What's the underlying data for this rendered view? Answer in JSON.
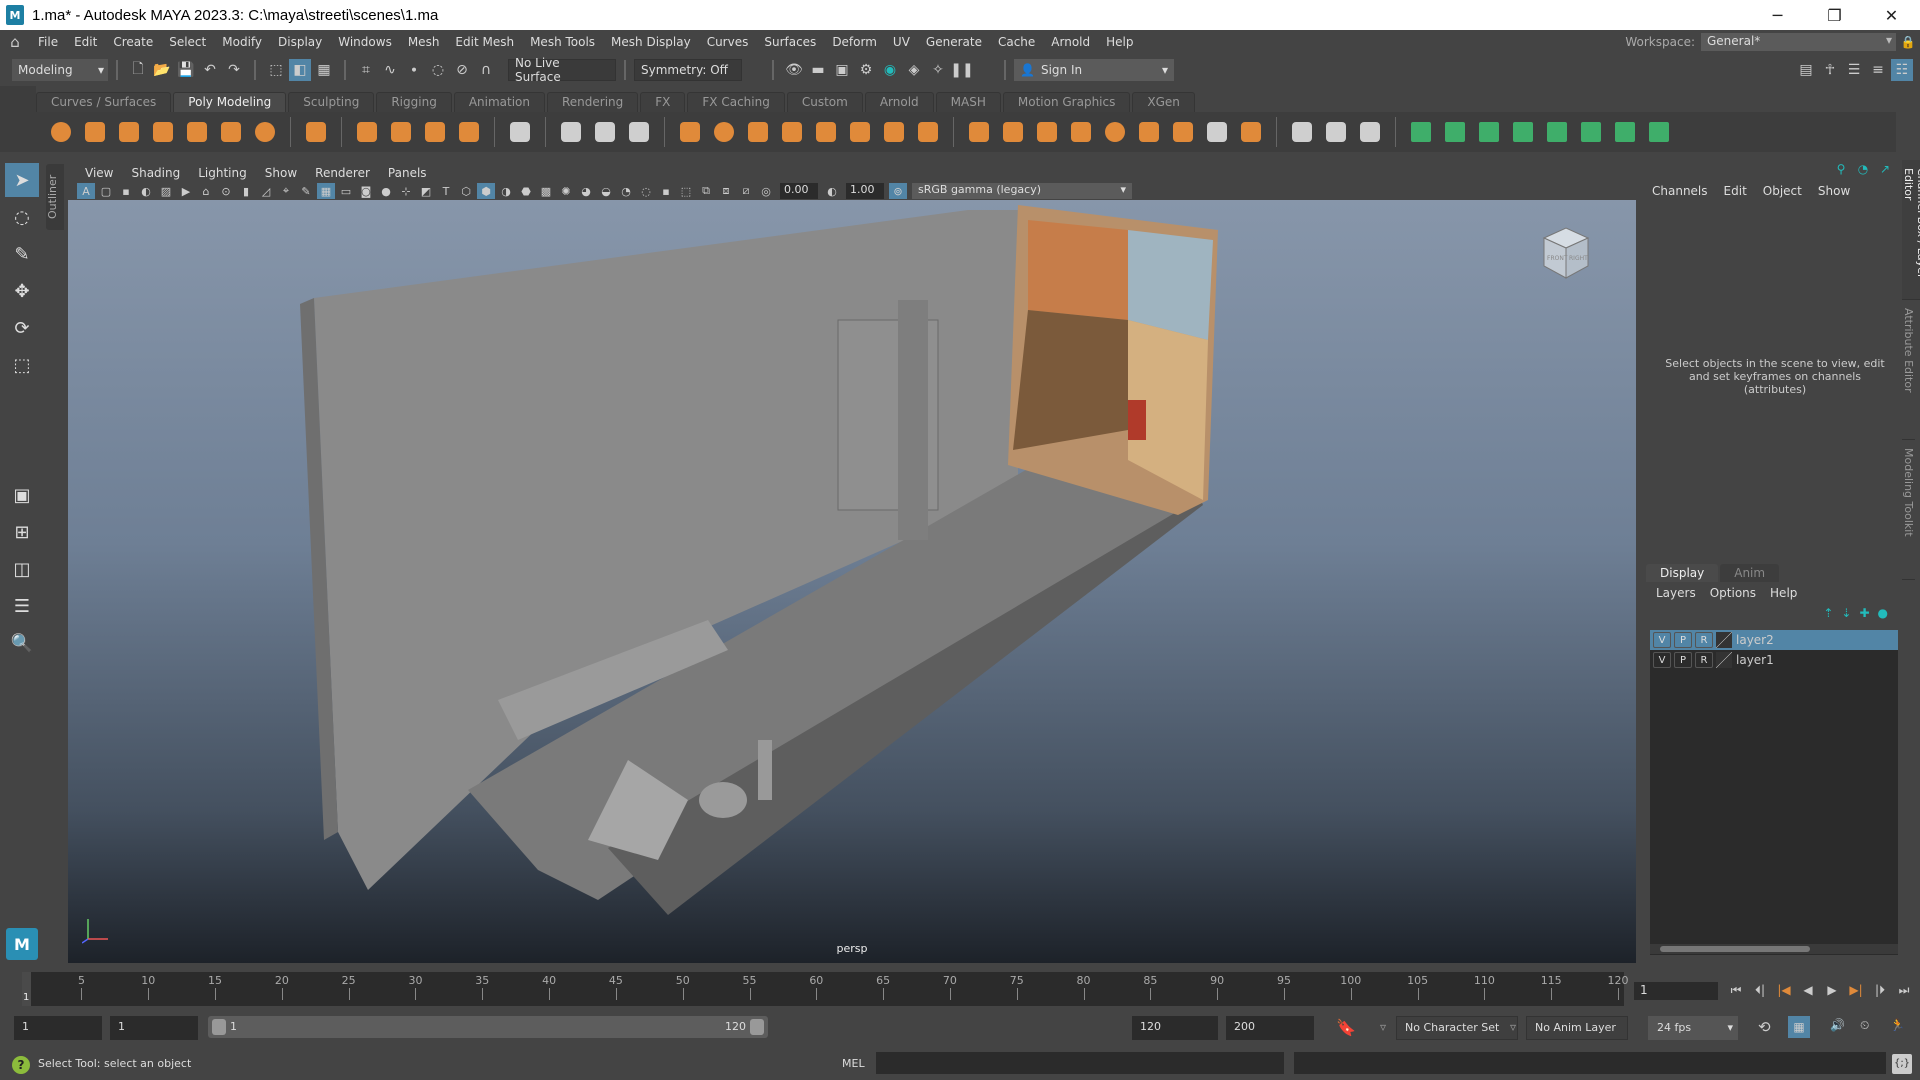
{
  "window": {
    "title": "1.ma* - Autodesk MAYA 2023.3: C:\\maya\\streeti\\scenes\\1.ma",
    "logo": "M"
  },
  "menubar": {
    "items": [
      "File",
      "Edit",
      "Create",
      "Select",
      "Modify",
      "Display",
      "Windows",
      "Mesh",
      "Edit Mesh",
      "Mesh Tools",
      "Mesh Display",
      "Curves",
      "Surfaces",
      "Deform",
      "UV",
      "Generate",
      "Cache",
      "Arnold",
      "Help"
    ],
    "workspace_label": "Workspace:",
    "workspace_value": "General*"
  },
  "statusline": {
    "mode": "Modeling",
    "live_surface": "No Live Surface",
    "symmetry": "Symmetry: Off",
    "sign_in": "Sign In"
  },
  "shelf": {
    "tabs": [
      "Curves / Surfaces",
      "Poly Modeling",
      "Sculpting",
      "Rigging",
      "Animation",
      "Rendering",
      "FX",
      "FX Caching",
      "Custom",
      "Arnold",
      "MASH",
      "Motion Graphics",
      "XGen"
    ],
    "active_tab": "Poly Modeling"
  },
  "toolbox": {
    "outliner_tab": "Outliner",
    "logo": "M"
  },
  "viewport": {
    "menus": [
      "View",
      "Shading",
      "Lighting",
      "Show",
      "Renderer",
      "Panels"
    ],
    "exposure": "0.00",
    "gamma": "1.00",
    "color_space": "sRGB gamma (legacy)",
    "camera": "persp",
    "viewcube": {
      "front": "FRONT",
      "right": "RIGHT"
    }
  },
  "channel_box": {
    "menus": [
      "Channels",
      "Edit",
      "Object",
      "Show"
    ],
    "message": "Select objects in the scene to view, edit and set keyframes on channels (attributes)"
  },
  "layer_editor": {
    "tabs": [
      "Display",
      "Anim"
    ],
    "menus": [
      "Layers",
      "Options",
      "Help"
    ],
    "layers": [
      {
        "v": "V",
        "p": "P",
        "r": "R",
        "name": "layer2",
        "selected": true
      },
      {
        "v": "V",
        "p": "P",
        "r": "R",
        "name": "layer1",
        "selected": false
      }
    ]
  },
  "side_tabs": [
    "Channel Box / Layer Editor",
    "Attribute Editor",
    "Modeling Toolkit"
  ],
  "timeline": {
    "start": 1,
    "end": 120,
    "current": "1",
    "ticks": [
      5,
      10,
      15,
      20,
      25,
      30,
      35,
      40,
      45,
      50,
      55,
      60,
      65,
      70,
      75,
      80,
      85,
      90,
      95,
      100,
      105,
      110,
      115,
      120
    ],
    "current_frame_field": "1"
  },
  "range": {
    "start_field": "1",
    "playback_start": "1",
    "range_start_label": "1",
    "range_end_label": "120",
    "playback_end": "120",
    "end_field": "200",
    "character_set": "No Character Set",
    "anim_layer": "No Anim Layer",
    "fps": "24 fps"
  },
  "commandline": {
    "help_message": "Select Tool: select an object",
    "lang": "MEL"
  }
}
